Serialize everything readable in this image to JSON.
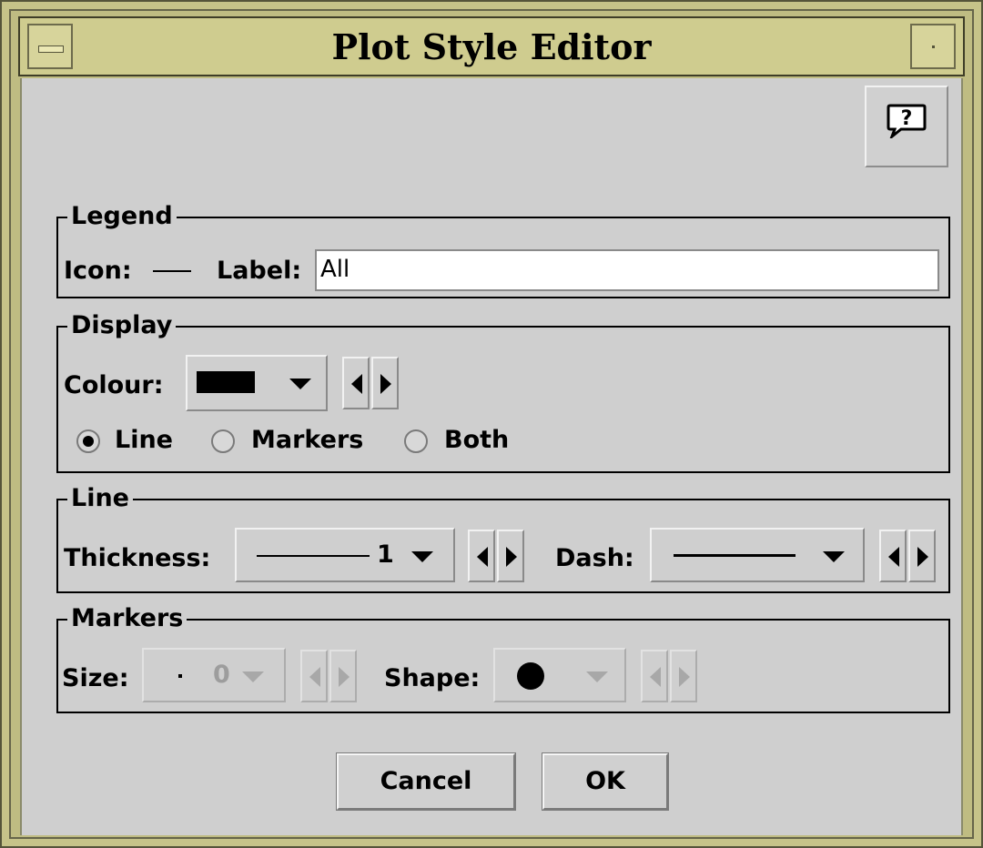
{
  "window": {
    "title": "Plot Style Editor"
  },
  "legend": {
    "group_title": "Legend",
    "icon_label": "Icon:",
    "label_label": "Label:",
    "label_value": "All"
  },
  "display": {
    "group_title": "Display",
    "colour_label": "Colour:",
    "colour_value": "#000000",
    "options": [
      "Line",
      "Markers",
      "Both"
    ],
    "selected": "Line"
  },
  "line": {
    "group_title": "Line",
    "thickness_label": "Thickness:",
    "thickness_value": "1",
    "dash_label": "Dash:"
  },
  "markers": {
    "group_title": "Markers",
    "size_label": "Size:",
    "size_value": "0",
    "shape_label": "Shape:",
    "shape_icon": "filled-circle"
  },
  "buttons": {
    "cancel": "Cancel",
    "ok": "OK"
  },
  "icons": {
    "help": "help-speech-bubble-icon"
  }
}
